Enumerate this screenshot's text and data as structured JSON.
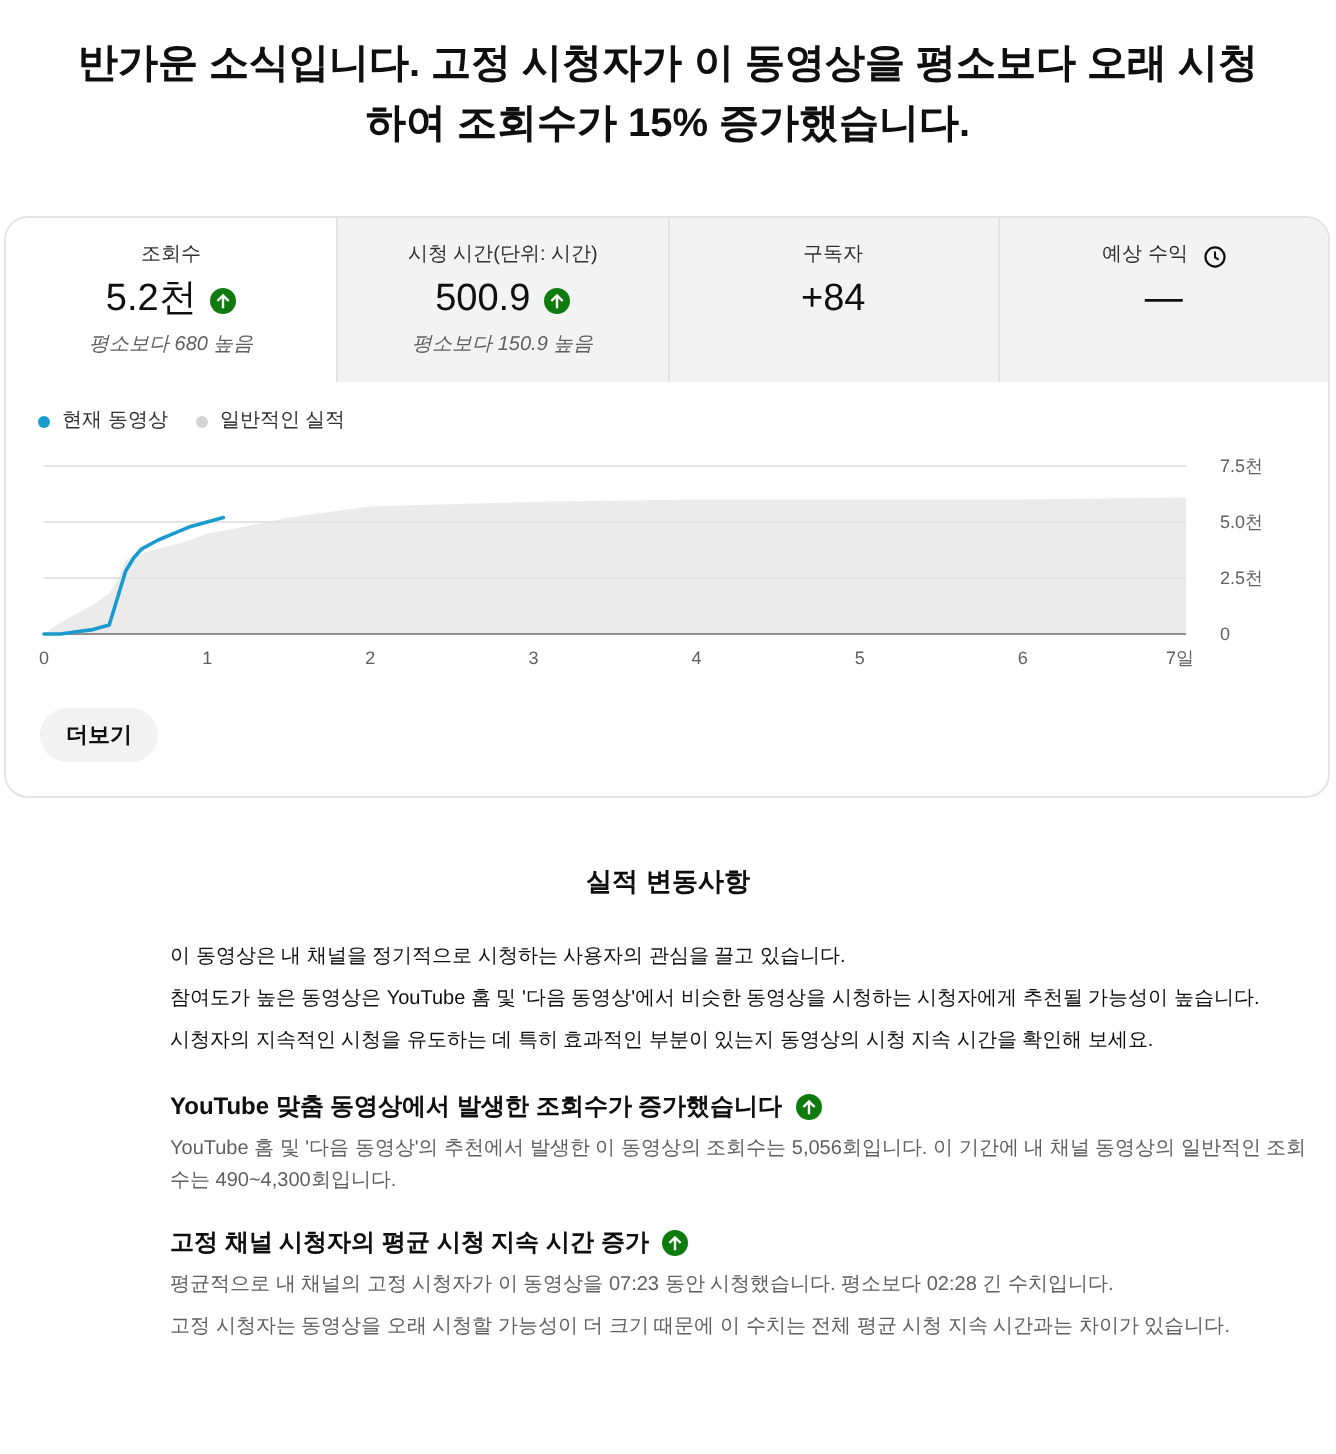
{
  "headline": "반가운 소식입니다. 고정 시청자가 이 동영상을 평소보다 오래 시청하여 조회수가 15% 증가했습니다.",
  "card": {
    "metrics": [
      {
        "kind": "metric",
        "label": "조회수",
        "value": "5.2천",
        "increased": true,
        "note": "평소보다 680 높음",
        "selected": true
      },
      {
        "kind": "metric",
        "label": "시청 시간(단위: 시간)",
        "value": "500.9",
        "increased": true,
        "note": "평소보다 150.9 높음",
        "selected": false
      },
      {
        "kind": "metric",
        "label": "구독자",
        "value": "+84",
        "increased": false,
        "selected": false
      },
      {
        "kind": "estimate",
        "label": "예상 수익",
        "value": "—",
        "increased": false,
        "selected": false
      }
    ],
    "chart_data": {
      "type": "line",
      "xlim": [
        0,
        7
      ],
      "ylim": [
        0,
        7.5
      ],
      "x": [
        0,
        0.1,
        0.2,
        0.3,
        0.4,
        0.45,
        0.5,
        0.55,
        0.6,
        0.7,
        0.8,
        0.9,
        1,
        1.1,
        1.5,
        2,
        3,
        4,
        5,
        6,
        7
      ],
      "series": [
        {
          "name": "현재 동영상",
          "color": "#1a9bd0",
          "values": [
            0,
            0,
            0.1,
            0.2,
            0.4,
            1.6,
            2.8,
            3.4,
            3.8,
            4.2,
            4.5,
            4.8,
            5,
            5.2,
            null,
            null,
            null,
            null,
            null,
            null,
            null
          ]
        },
        {
          "name": "일반적인 실적",
          "type": "area",
          "color": "#d3d3d3",
          "values": [
            0,
            0.5,
            0.9,
            1.3,
            1.8,
            2.4,
            3.3,
            3.5,
            3.6,
            3.8,
            4.0,
            4.2,
            4.5,
            4.6,
            5.2,
            5.7,
            5.9,
            6.0,
            6.0,
            6.0,
            6.1
          ]
        }
      ],
      "xticks": [
        0,
        1,
        2,
        3,
        4,
        5,
        6,
        {
          "value": 7,
          "label": "7일"
        }
      ],
      "yticks": [
        0,
        {
          "value": 2.5,
          "label": "2.5천"
        },
        {
          "value": 5,
          "label": "5.0천"
        },
        {
          "value": 7.5,
          "label": "7.5천"
        }
      ]
    },
    "more_button": "더보기"
  },
  "performance": {
    "title": "실적 변동사항",
    "intro": [
      "이 동영상은 내 채널을 정기적으로 시청하는 사용자의 관심을 끌고 있습니다.",
      "참여도가 높은 동영상은 YouTube 홈 및 '다음 동영상'에서 비슷한 동영상을 시청하는 시청자에게 추천될 가능성이 높습니다.",
      "시청자의 지속적인 시청을 유도하는 데 특히 효과적인 부분이 있는지 동영상의 시청 지속 시간을 확인해 보세요."
    ],
    "insights": [
      {
        "title": "YouTube 맞춤 동영상에서 발생한 조회수가 증가했습니다",
        "increased": true,
        "paragraphs": [
          "YouTube 홈 및 '다음 동영상'의 추천에서 발생한 이 동영상의 조회수는 5,056회입니다. 이 기간에 내 채널 동영상의 일반적인 조회수는 490~4,300회입니다."
        ]
      },
      {
        "title": "고정 채널 시청자의 평균 시청 지속 시간 증가",
        "increased": true,
        "paragraphs": [
          "평균적으로 내 채널의 고정 시청자가 이 동영상을 07:23 동안 시청했습니다. 평소보다 02:28 긴 수치입니다.",
          "고정 시청자는 동영상을 오래 시청할 가능성이 더 크기 때문에 이 수치는 전체 평균 시청 지속 시간과는 차이가 있습니다."
        ]
      }
    ]
  }
}
